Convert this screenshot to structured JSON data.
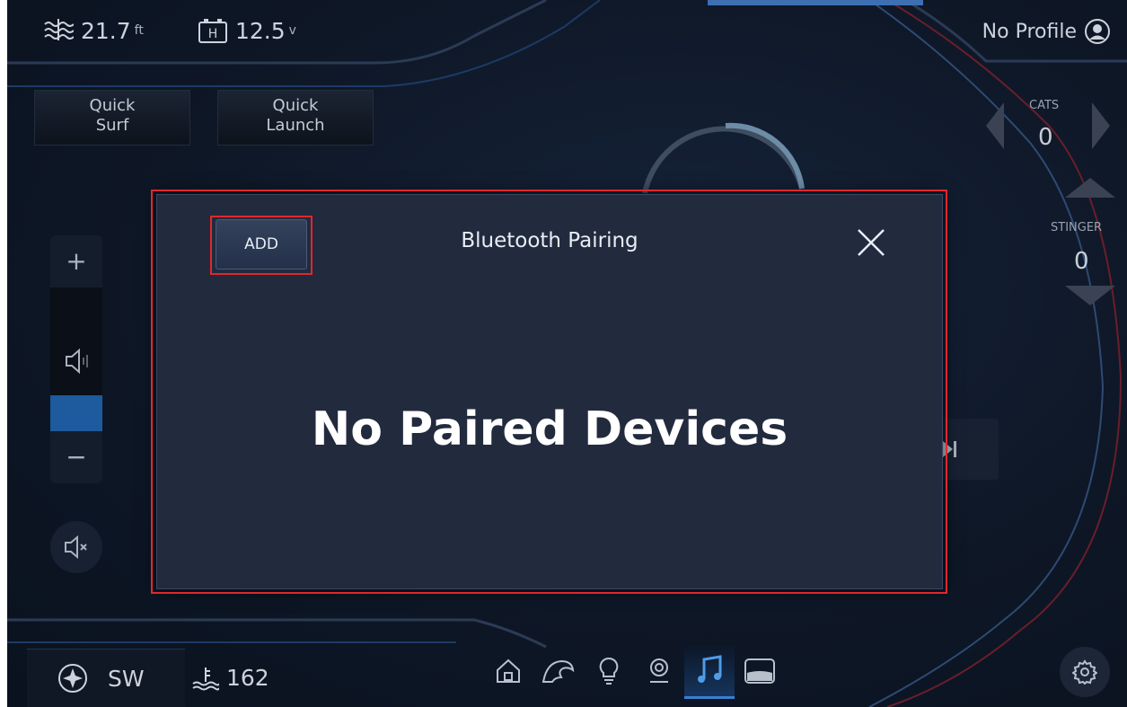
{
  "status": {
    "depth_value": "21.7",
    "depth_unit": "ft",
    "battery_value": "12.5",
    "battery_unit": "v",
    "battery_icon_letter": "H",
    "profile_label": "No Profile"
  },
  "quick_buttons": [
    {
      "line1": "Quick",
      "line2": "Surf"
    },
    {
      "line1": "Quick",
      "line2": "Launch"
    }
  ],
  "volume": {
    "plus_label": "+",
    "minus_label": "−"
  },
  "right_controls": {
    "cats_label": "CATS",
    "cats_value": "0",
    "stinger_label": "STINGER",
    "stinger_value": "0"
  },
  "bottom": {
    "heading": "SW",
    "water_depth": "162",
    "nav_items": [
      "home-icon",
      "wave-icon",
      "light-icon",
      "location-icon",
      "music-icon",
      "ballast-icon"
    ],
    "active_nav": "music-icon"
  },
  "modal": {
    "add_label": "ADD",
    "title": "Bluetooth Pairing",
    "empty_message": "No Paired Devices"
  },
  "colors": {
    "accent": "#3a7fd0",
    "highlight": "#e0282c",
    "modal_bg": "#222a3e",
    "screen_bg": "#0e1726"
  }
}
